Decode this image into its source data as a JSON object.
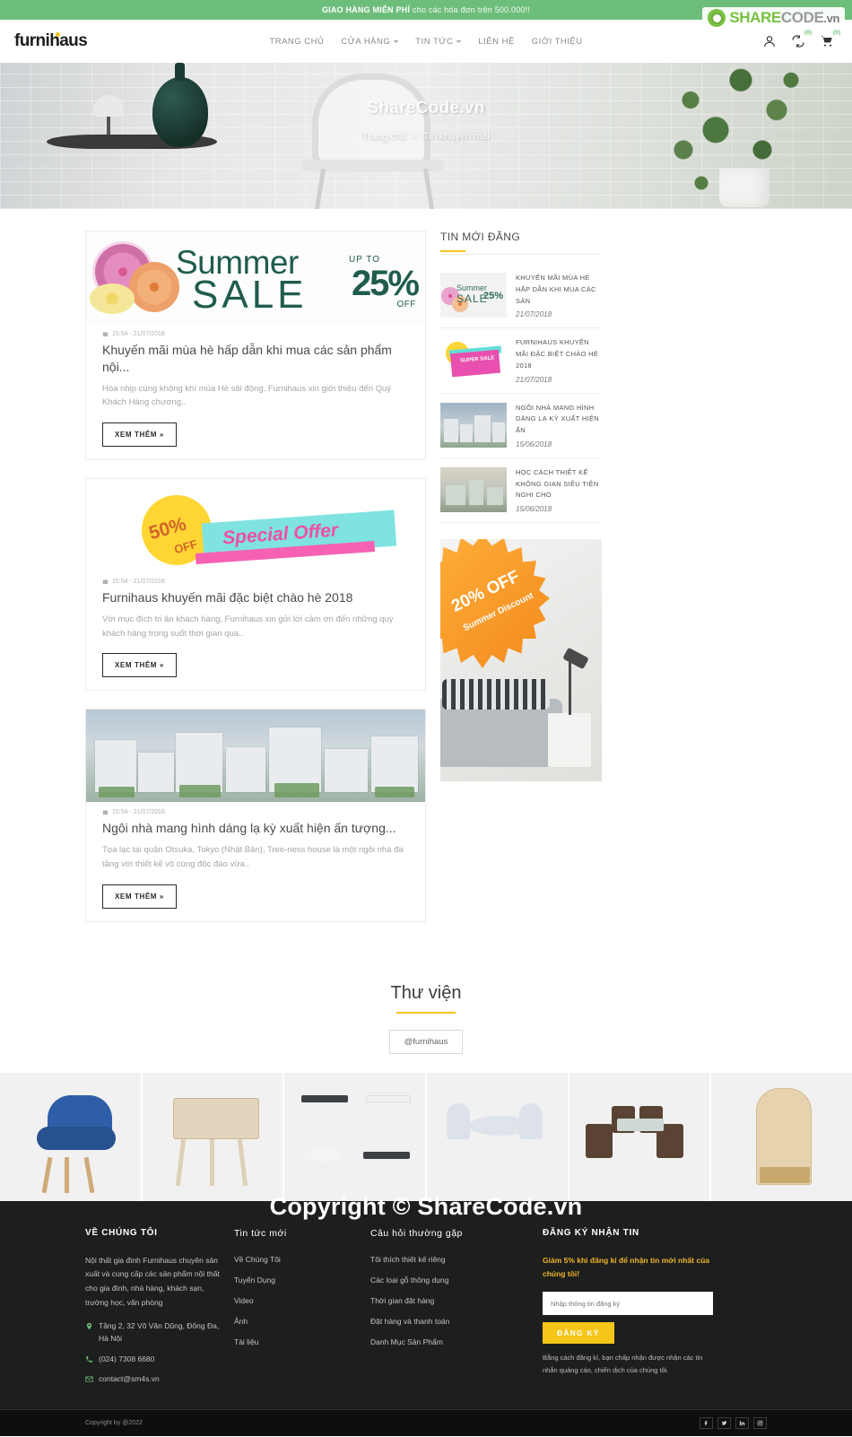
{
  "topbar": {
    "bold": "GIAO HÀNG MIỄN PHÍ",
    "rest": "cho các hóa đơn trên 500.000!!"
  },
  "watermark": {
    "part1": "SHARE",
    "part2": "CODE",
    "part3": ".vn",
    "hero_text": "ShareCode.vn",
    "big_text": "Copyright © ShareCode.vn"
  },
  "header": {
    "logo": "furnihaus",
    "nav": [
      {
        "label": "TRANG CHỦ",
        "dropdown": false
      },
      {
        "label": "CỬA HÀNG",
        "dropdown": true
      },
      {
        "label": "TIN TỨC",
        "dropdown": true
      },
      {
        "label": "LIÊN HỆ",
        "dropdown": false
      },
      {
        "label": "GIỚI THIỆU",
        "dropdown": false
      }
    ],
    "icons": [
      {
        "name": "user-icon",
        "badge": null
      },
      {
        "name": "compare-icon",
        "badge": "0"
      },
      {
        "name": "cart-icon",
        "badge": "0"
      }
    ]
  },
  "hero": {
    "breadcrumb_home": "Trang chủ",
    "breadcrumb_sep": ">",
    "breadcrumb_current": "Tin khuyến mãi"
  },
  "articles": [
    {
      "banner": {
        "kind": "summer-sale",
        "word1": "Summer",
        "word2": "SALE",
        "upto": "UP TO",
        "pct": "25%",
        "off": "OFF"
      },
      "date": "15:54 - 21/07/2018",
      "title": "Khuyến mãi mùa hè hấp dẫn khi mua các sản phẩm nội...",
      "excerpt": "Hòa nhịp cùng không khí mùa Hè sôi động, Furnihaus xin giới thiệu đến Quý Khách Hàng chương..",
      "button": "XEM THÊM »"
    },
    {
      "banner": {
        "kind": "special-offer",
        "fifty": "50%",
        "off": "OFF",
        "special": "Special Offer"
      },
      "date": "15:54 - 21/07/2018",
      "title": "Furnihaus khuyến mãi đặc biệt chào hè 2018",
      "excerpt": "Với mục đích tri ân khách hàng, Furnihaus xin gửi lời cảm ơn đến những quý khách hàng trong suốt thời gian qua..",
      "button": "XEM THÊM »"
    },
    {
      "banner": {
        "kind": "house-photo"
      },
      "date": "15:54 - 21/07/2018",
      "title": "Ngôi nhà mang hình dáng lạ kỳ xuất hiện ấn tượng...",
      "excerpt": "Tọa lạc tại quận Otsuka, Tokyo (Nhật Bản), Tree-ness house là một ngôi nhà đa tầng với thiết kế vô cùng độc đáo vừa..",
      "button": "XEM THÊM »"
    }
  ],
  "sidebar": {
    "title": "TIN MỚI ĐĂNG",
    "items": [
      {
        "thumb": "summer-sale-thumb",
        "heading": "KHUYẾN MÃI MÙA HÈ HẤP DẪN KHI MUA CÁC SẢN",
        "date": "21/07/2018",
        "thumb_text1": "Summer",
        "thumb_text2": "SALE",
        "thumb_pct": "25%"
      },
      {
        "thumb": "super-sale-thumb",
        "heading": "FURNIHAUS KHUYẾN MÃI ĐẶC BIỆT CHÀO HÈ 2018",
        "date": "21/07/2018",
        "thumb_label": "SUPER SALE"
      },
      {
        "thumb": "house-thumb",
        "heading": "NGÔI NHÀ MANG HÌNH DÁNG LẠ KỲ XUẤT HIỆN ẤN",
        "date": "15/06/2018"
      },
      {
        "thumb": "interior-thumb",
        "heading": "HỌC CÁCH THIẾT KẾ KHÔNG GIAN SIÊU TIỆN NGHI CHO",
        "date": "15/06/2018"
      }
    ],
    "promo": {
      "headline": "20% OFF",
      "subline": "Summer Discount"
    }
  },
  "gallery": {
    "title": "Thư viện",
    "tag": "@furnihaus",
    "items": [
      {
        "name": "blue-armchair"
      },
      {
        "name": "wooden-nightstand"
      },
      {
        "name": "dining-tables-set"
      },
      {
        "name": "round-table-chairs"
      },
      {
        "name": "rattan-patio-set"
      },
      {
        "name": "wooden-cabinet"
      }
    ]
  },
  "footer": {
    "col1": {
      "title": "VỀ CHÚNG TÔI",
      "desc": "Nội thất gia đình Furnihaus chuyên sản xuất và cung cấp các sản phẩm nội thất cho gia đình, nhà hàng, khách sạn, trường học, văn phòng",
      "address": "Tầng 2, 32 Võ Văn Dũng, Đống Đa, Hà Nội",
      "phone": "(024) 7308 6680",
      "email": "contact@sm4s.vn"
    },
    "col2": {
      "title": "Tin tức mới",
      "links": [
        "Về Chúng Tôi",
        "Tuyển Dụng",
        "Video",
        "Ảnh",
        "Tài liệu"
      ]
    },
    "col3": {
      "title": "Câu hỏi thường gặp",
      "links": [
        "Tôi thích thiết kế riêng",
        "Các loại gỗ thông dụng",
        "Thời gian đặt hàng",
        "Đặt hàng và thanh toán",
        "Danh Mục Sản Phẩm"
      ]
    },
    "col4": {
      "title": "ĐĂNG KÝ NHẬN TIN",
      "sub": "Giảm 5% khi đăng kí để nhận tin mới nhất của chúng tôi!",
      "placeholder": "Nhập thông tin đăng ký",
      "button": "ĐĂNG KÝ",
      "note": "Bằng cách đăng kí, bạn chấp nhận được nhận các tin nhắn quảng cáo, chiến dịch của chúng tôi."
    },
    "bottom": {
      "copyright": "Copyright by @2022",
      "socials": [
        "facebook-icon",
        "twitter-icon",
        "linkedin-icon",
        "instagram-icon"
      ]
    }
  },
  "colors": {
    "green": "#6ebe7b",
    "yellow": "#f5c518",
    "dark": "#1d1f1e",
    "orange": "#f38a1c"
  }
}
